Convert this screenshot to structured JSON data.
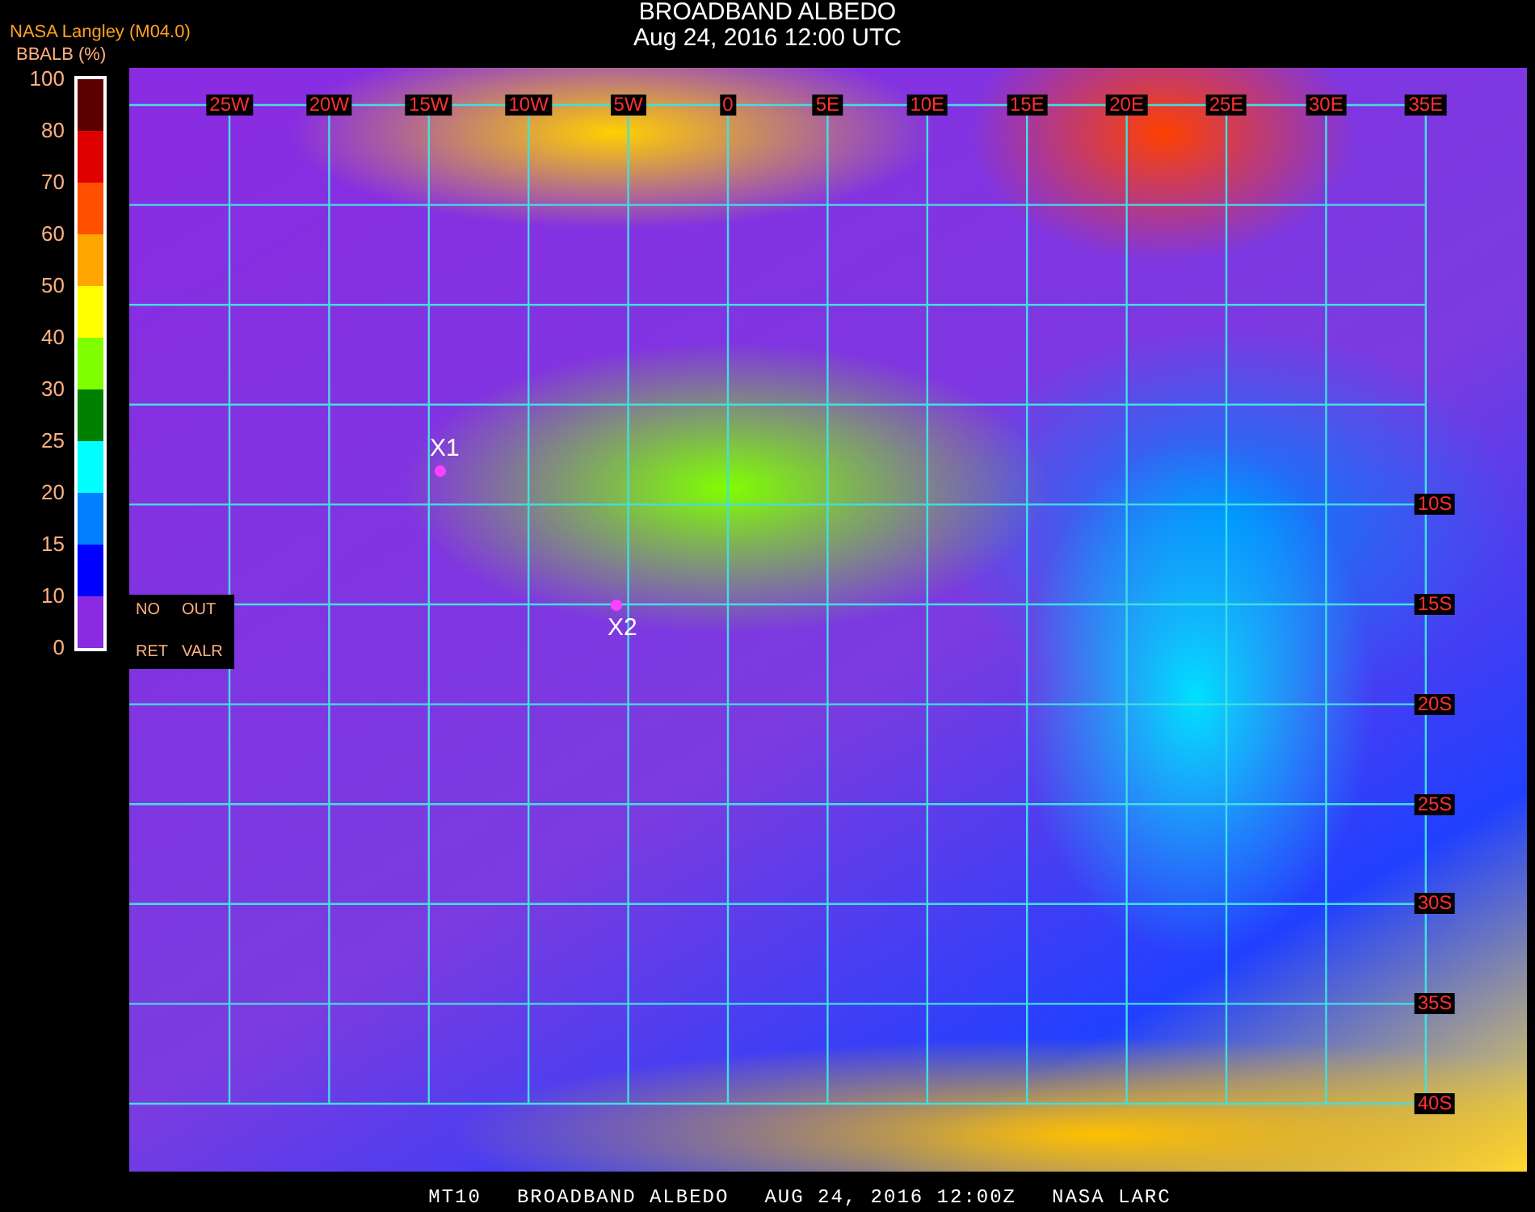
{
  "header": {
    "title": "BROADBAND ALBEDO",
    "subtitle": "Aug 24, 2016 12:00 UTC",
    "source": "NASA Langley (M04.0)"
  },
  "colorbar": {
    "label": "BBALB (%)",
    "ticks": [
      "100",
      "80",
      "70",
      "60",
      "50",
      "40",
      "30",
      "25",
      "20",
      "15",
      "10",
      "0"
    ],
    "segments": [
      {
        "color": "#5a0000"
      },
      {
        "color": "#e00000"
      },
      {
        "color": "#ff5000"
      },
      {
        "color": "#ffa500"
      },
      {
        "color": "#ffff00"
      },
      {
        "color": "#80ff00"
      },
      {
        "color": "#008000"
      },
      {
        "color": "#00ffff"
      },
      {
        "color": "#0080ff"
      },
      {
        "color": "#0000ff"
      },
      {
        "color": "#8a2be2"
      }
    ]
  },
  "map": {
    "longitude_labels": [
      "25W",
      "20W",
      "15W",
      "10W",
      "5W",
      "0",
      "5E",
      "10E",
      "15E",
      "20E",
      "25E",
      "30E",
      "35E"
    ],
    "latitude_labels": [
      "10S",
      "15S",
      "20S",
      "25S",
      "30S",
      "35S",
      "40S"
    ],
    "markers": [
      {
        "label": "X1"
      },
      {
        "label": "X2"
      }
    ],
    "legend": [
      "NO",
      "OUT",
      "RET",
      "VALR"
    ]
  },
  "footer": {
    "items": [
      "MT10",
      "BROADBAND ALBEDO",
      "AUG 24, 2016 12:00Z",
      "NASA LARC"
    ]
  }
}
